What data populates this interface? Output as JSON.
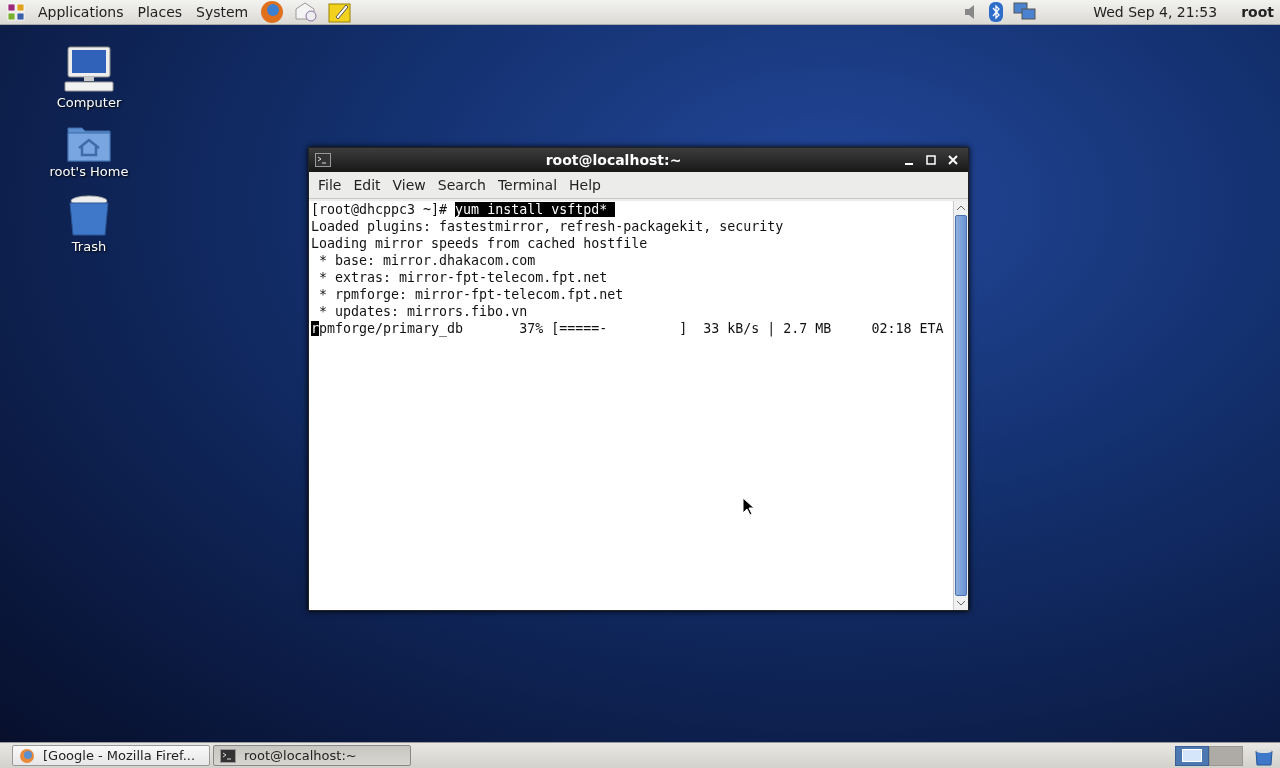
{
  "top_panel": {
    "menus": [
      "Applications",
      "Places",
      "System"
    ],
    "clock": "Wed Sep  4, 21:53",
    "user": "root"
  },
  "desktop_icons": [
    {
      "kind": "computer",
      "label": "Computer"
    },
    {
      "kind": "home",
      "label": "root's Home"
    },
    {
      "kind": "trash",
      "label": "Trash"
    }
  ],
  "terminal": {
    "title": "root@localhost:~",
    "menu": [
      "File",
      "Edit",
      "View",
      "Search",
      "Terminal",
      "Help"
    ],
    "lines": [
      {
        "kind": "prompt",
        "prompt": "[root@dhcppc3 ~]# ",
        "command": "yum install vsftpd* "
      },
      {
        "kind": "output",
        "text": "Loaded plugins: fastestmirror, refresh-packagekit, security"
      },
      {
        "kind": "output",
        "text": "Loading mirror speeds from cached hostfile"
      },
      {
        "kind": "output",
        "text": " * base: mirror.dhakacom.com"
      },
      {
        "kind": "output",
        "text": " * extras: mirror-fpt-telecom.fpt.net"
      },
      {
        "kind": "output",
        "text": " * rpmforge: mirror-fpt-telecom.fpt.net"
      },
      {
        "kind": "output",
        "text": " * updates: mirrors.fibo.vn"
      },
      {
        "kind": "cursor",
        "cursor_char": "r",
        "text": "pmforge/primary_db       37% [=====-         ]  33 kB/s | 2.7 MB     02:18 ETA"
      }
    ]
  },
  "taskbar": {
    "items": [
      {
        "kind": "browser",
        "label": "[Google - Mozilla Firef...",
        "selected": false
      },
      {
        "kind": "terminal",
        "label": "root@localhost:~",
        "selected": true
      }
    ],
    "workspaces": [
      {
        "selected": true
      },
      {
        "selected": false
      }
    ]
  }
}
